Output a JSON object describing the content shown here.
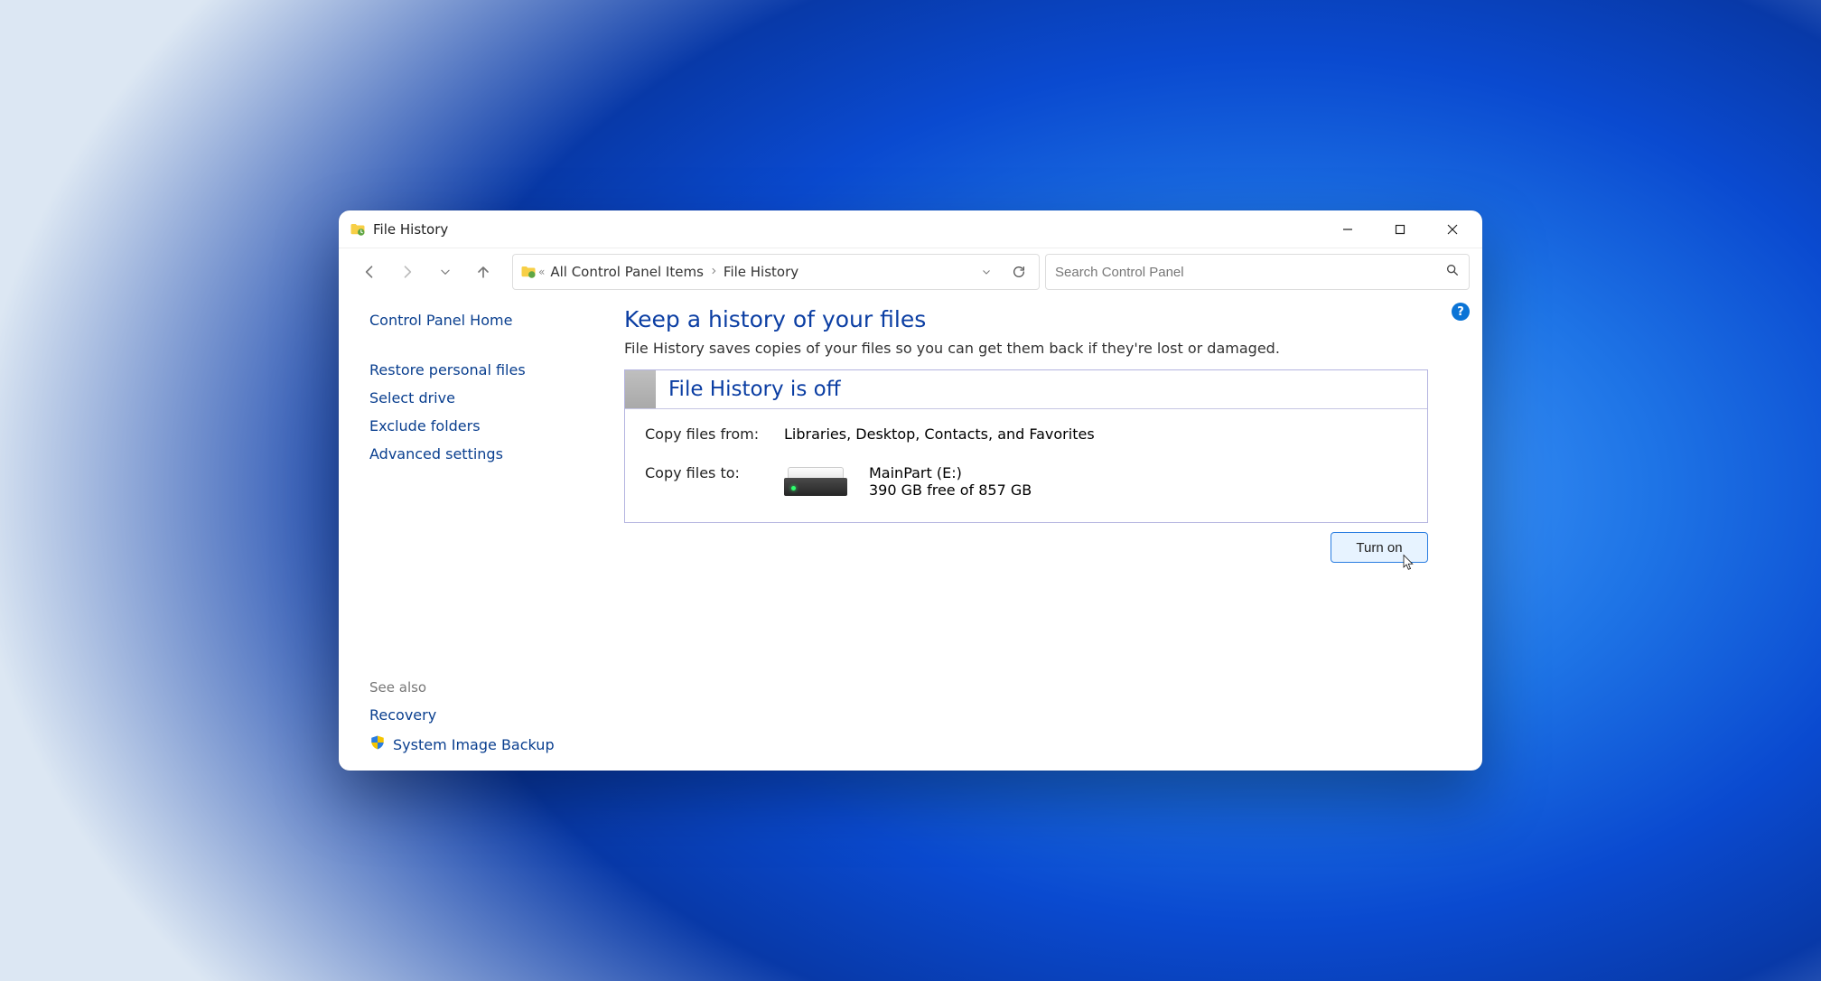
{
  "window": {
    "title": "File History"
  },
  "breadcrumb": {
    "items": [
      "All Control Panel Items",
      "File History"
    ]
  },
  "search": {
    "placeholder": "Search Control Panel"
  },
  "sidebar": {
    "home": "Control Panel Home",
    "links": [
      "Restore personal files",
      "Select drive",
      "Exclude folders",
      "Advanced settings"
    ],
    "see_also_label": "See also",
    "see_also": [
      "Recovery",
      "System Image Backup"
    ]
  },
  "main": {
    "title": "Keep a history of your files",
    "description": "File History saves copies of your files so you can get them back if they're lost or damaged.",
    "status": "File History is off",
    "copy_from_label": "Copy files from:",
    "copy_from_value": "Libraries, Desktop, Contacts, and Favorites",
    "copy_to_label": "Copy files to:",
    "drive_name": "MainPart (E:)",
    "drive_free": "390 GB free of 857 GB",
    "action_button": "Turn on"
  }
}
